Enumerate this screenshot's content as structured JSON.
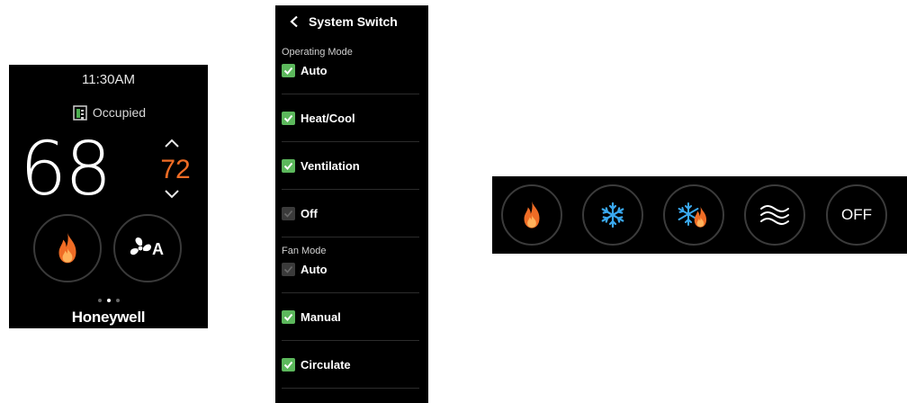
{
  "thermostat": {
    "time": "11:30AM",
    "occupancy": "Occupied",
    "indoor_temp": "68",
    "setpoint": "72",
    "fan_mode_letter": "A",
    "brand": "Honeywell",
    "colors": {
      "heat": "#ef6c25",
      "background": "#000000"
    }
  },
  "system_switch": {
    "title": "System Switch",
    "operating_mode_label": "Operating Mode",
    "operating_modes": [
      {
        "label": "Auto",
        "checked": true
      },
      {
        "label": "Heat/Cool",
        "checked": true
      },
      {
        "label": "Ventilation",
        "checked": true
      },
      {
        "label": "Off",
        "checked": false
      }
    ],
    "fan_mode_label": "Fan Mode",
    "fan_modes": [
      {
        "label": "Auto",
        "checked": false
      },
      {
        "label": "Manual",
        "checked": true
      },
      {
        "label": "Circulate",
        "checked": true
      }
    ],
    "colors": {
      "checked": "#5cb85c",
      "unchecked": "#3b3b3b"
    }
  },
  "mode_bar": {
    "buttons": [
      {
        "icon": "flame-icon"
      },
      {
        "icon": "snowflake-icon"
      },
      {
        "icon": "snowflake-flame-icon"
      },
      {
        "icon": "ventilation-icon"
      },
      {
        "label": "OFF"
      }
    ],
    "colors": {
      "cool": "#3aa9f0",
      "heat": "#ef6c25"
    }
  }
}
